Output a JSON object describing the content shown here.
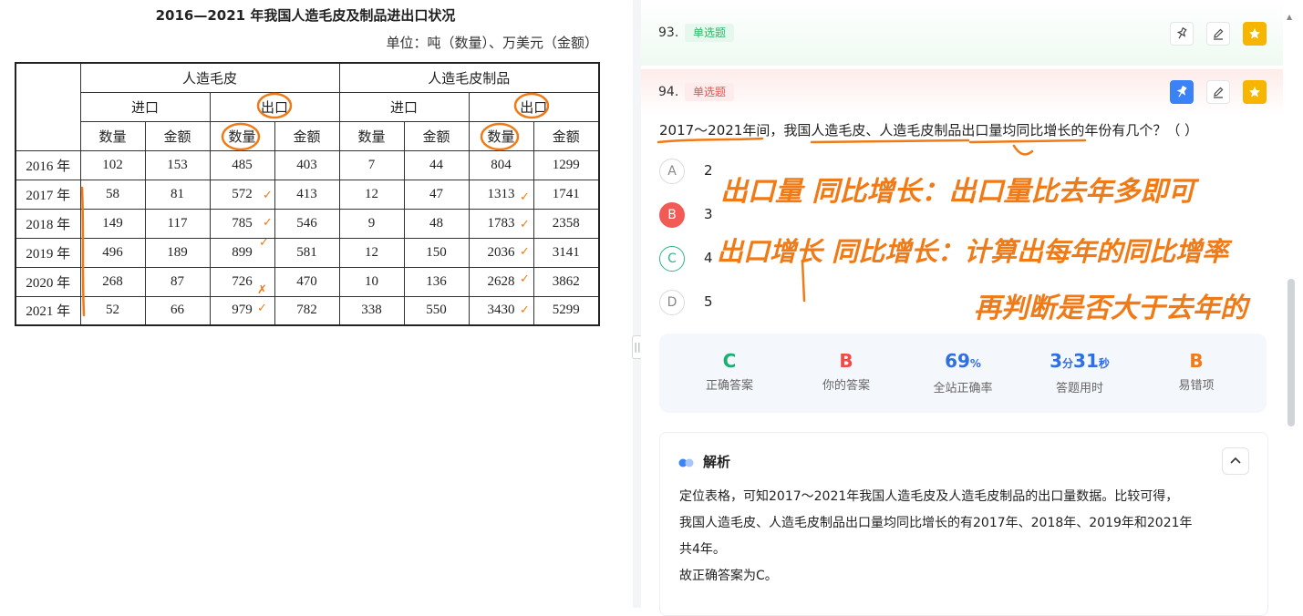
{
  "left": {
    "title": "2016—2021 年我国人造毛皮及制品进出口状况",
    "unit": "单位：吨（数量）、万美元（金额）",
    "groups": [
      "人造毛皮",
      "人造毛皮制品"
    ],
    "directions": [
      "进口",
      "出口",
      "进口",
      "出口"
    ],
    "cols": [
      "数量",
      "金额",
      "数量",
      "金额",
      "数量",
      "金额",
      "数量",
      "金额"
    ],
    "rows": [
      {
        "year": "2016 年",
        "cells": [
          "102",
          "153",
          "485",
          "403",
          "7",
          "44",
          "804",
          "1299"
        ]
      },
      {
        "year": "2017 年",
        "cells": [
          "58",
          "81",
          "572",
          "413",
          "12",
          "47",
          "1313",
          "1741"
        ]
      },
      {
        "year": "2018 年",
        "cells": [
          "149",
          "117",
          "785",
          "546",
          "9",
          "48",
          "1783",
          "2358"
        ]
      },
      {
        "year": "2019 年",
        "cells": [
          "496",
          "189",
          "899",
          "581",
          "12",
          "150",
          "2036",
          "3141"
        ]
      },
      {
        "year": "2020 年",
        "cells": [
          "268",
          "87",
          "726",
          "470",
          "10",
          "136",
          "2628",
          "3862"
        ]
      },
      {
        "year": "2021 年",
        "cells": [
          "52",
          "66",
          "979",
          "782",
          "338",
          "550",
          "3430",
          "5299"
        ]
      }
    ]
  },
  "divider": {
    "handle": "||"
  },
  "q93": {
    "number": "93.",
    "tag": "单选题"
  },
  "q94": {
    "number": "94.",
    "tag": "单选题",
    "text": "2017～2021年间，我国人造毛皮、人造毛皮制品出口量均同比增长的年份有几个？（ ）"
  },
  "icons": {
    "pin": "pin-icon",
    "edit": "edit-icon",
    "star": "star-icon"
  },
  "options": [
    {
      "letter": "A",
      "text": "2",
      "state": "normal"
    },
    {
      "letter": "B",
      "text": "3",
      "state": "wrong"
    },
    {
      "letter": "C",
      "text": "4",
      "state": "right"
    },
    {
      "letter": "D",
      "text": "5",
      "state": "normal"
    }
  ],
  "stats": {
    "correct": {
      "value": "C",
      "label": "正确答案"
    },
    "yours": {
      "value": "B",
      "label": "你的答案"
    },
    "rate": {
      "value": "69",
      "unit": "%",
      "label": "全站正确率"
    },
    "time": {
      "min": "3",
      "min_unit": "分",
      "sec": "31",
      "sec_unit": "秒",
      "label": "答题用时"
    },
    "error": {
      "value": "B",
      "label": "易错项"
    }
  },
  "analysis": {
    "title": "解析",
    "collapse": "^",
    "p1": "定位表格，可知2017～2021年我国人造毛皮及人造毛皮制品的出口量数据。比较可得，",
    "p2": "我国人造毛皮、人造毛皮制品出口量均同比增长的有2017年、2018年、2019年和2021年",
    "p3": "共4年。",
    "p4": "故正确答案为C。"
  },
  "handwriting": {
    "line1": "出口量 同比增长：出口量比去年多即可",
    "line2": "出口增长 同比增长：计算出每年的同比增率",
    "line3": "再判断是否大于去年的",
    "marks": [
      "✓",
      "✓",
      "✓",
      "✗",
      "✓",
      "✓",
      "✓",
      "✓",
      "✓",
      "✓"
    ]
  },
  "colors": {
    "ink": "#f07a16",
    "accent_blue": "#3b82f6",
    "gold": "#f7b500",
    "correct_green": "#19b070",
    "wrong_red": "#f04a44"
  }
}
